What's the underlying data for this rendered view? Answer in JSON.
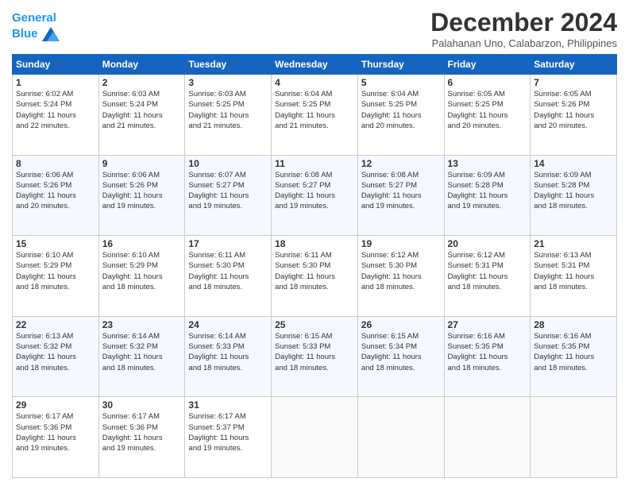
{
  "header": {
    "logo_line1": "General",
    "logo_line2": "Blue",
    "month_title": "December 2024",
    "location": "Palahanan Uno, Calabarzon, Philippines"
  },
  "days_of_week": [
    "Sunday",
    "Monday",
    "Tuesday",
    "Wednesday",
    "Thursday",
    "Friday",
    "Saturday"
  ],
  "weeks": [
    [
      {
        "day": "1",
        "text": "Sunrise: 6:02 AM\nSunset: 5:24 PM\nDaylight: 11 hours\nand 22 minutes."
      },
      {
        "day": "2",
        "text": "Sunrise: 6:03 AM\nSunset: 5:24 PM\nDaylight: 11 hours\nand 21 minutes."
      },
      {
        "day": "3",
        "text": "Sunrise: 6:03 AM\nSunset: 5:25 PM\nDaylight: 11 hours\nand 21 minutes."
      },
      {
        "day": "4",
        "text": "Sunrise: 6:04 AM\nSunset: 5:25 PM\nDaylight: 11 hours\nand 21 minutes."
      },
      {
        "day": "5",
        "text": "Sunrise: 6:04 AM\nSunset: 5:25 PM\nDaylight: 11 hours\nand 20 minutes."
      },
      {
        "day": "6",
        "text": "Sunrise: 6:05 AM\nSunset: 5:25 PM\nDaylight: 11 hours\nand 20 minutes."
      },
      {
        "day": "7",
        "text": "Sunrise: 6:05 AM\nSunset: 5:26 PM\nDaylight: 11 hours\nand 20 minutes."
      }
    ],
    [
      {
        "day": "8",
        "text": "Sunrise: 6:06 AM\nSunset: 5:26 PM\nDaylight: 11 hours\nand 20 minutes."
      },
      {
        "day": "9",
        "text": "Sunrise: 6:06 AM\nSunset: 5:26 PM\nDaylight: 11 hours\nand 19 minutes."
      },
      {
        "day": "10",
        "text": "Sunrise: 6:07 AM\nSunset: 5:27 PM\nDaylight: 11 hours\nand 19 minutes."
      },
      {
        "day": "11",
        "text": "Sunrise: 6:08 AM\nSunset: 5:27 PM\nDaylight: 11 hours\nand 19 minutes."
      },
      {
        "day": "12",
        "text": "Sunrise: 6:08 AM\nSunset: 5:27 PM\nDaylight: 11 hours\nand 19 minutes."
      },
      {
        "day": "13",
        "text": "Sunrise: 6:09 AM\nSunset: 5:28 PM\nDaylight: 11 hours\nand 19 minutes."
      },
      {
        "day": "14",
        "text": "Sunrise: 6:09 AM\nSunset: 5:28 PM\nDaylight: 11 hours\nand 18 minutes."
      }
    ],
    [
      {
        "day": "15",
        "text": "Sunrise: 6:10 AM\nSunset: 5:29 PM\nDaylight: 11 hours\nand 18 minutes."
      },
      {
        "day": "16",
        "text": "Sunrise: 6:10 AM\nSunset: 5:29 PM\nDaylight: 11 hours\nand 18 minutes."
      },
      {
        "day": "17",
        "text": "Sunrise: 6:11 AM\nSunset: 5:30 PM\nDaylight: 11 hours\nand 18 minutes."
      },
      {
        "day": "18",
        "text": "Sunrise: 6:11 AM\nSunset: 5:30 PM\nDaylight: 11 hours\nand 18 minutes."
      },
      {
        "day": "19",
        "text": "Sunrise: 6:12 AM\nSunset: 5:30 PM\nDaylight: 11 hours\nand 18 minutes."
      },
      {
        "day": "20",
        "text": "Sunrise: 6:12 AM\nSunset: 5:31 PM\nDaylight: 11 hours\nand 18 minutes."
      },
      {
        "day": "21",
        "text": "Sunrise: 6:13 AM\nSunset: 5:31 PM\nDaylight: 11 hours\nand 18 minutes."
      }
    ],
    [
      {
        "day": "22",
        "text": "Sunrise: 6:13 AM\nSunset: 5:32 PM\nDaylight: 11 hours\nand 18 minutes."
      },
      {
        "day": "23",
        "text": "Sunrise: 6:14 AM\nSunset: 5:32 PM\nDaylight: 11 hours\nand 18 minutes."
      },
      {
        "day": "24",
        "text": "Sunrise: 6:14 AM\nSunset: 5:33 PM\nDaylight: 11 hours\nand 18 minutes."
      },
      {
        "day": "25",
        "text": "Sunrise: 6:15 AM\nSunset: 5:33 PM\nDaylight: 11 hours\nand 18 minutes."
      },
      {
        "day": "26",
        "text": "Sunrise: 6:15 AM\nSunset: 5:34 PM\nDaylight: 11 hours\nand 18 minutes."
      },
      {
        "day": "27",
        "text": "Sunrise: 6:16 AM\nSunset: 5:35 PM\nDaylight: 11 hours\nand 18 minutes."
      },
      {
        "day": "28",
        "text": "Sunrise: 6:16 AM\nSunset: 5:35 PM\nDaylight: 11 hours\nand 18 minutes."
      }
    ],
    [
      {
        "day": "29",
        "text": "Sunrise: 6:17 AM\nSunset: 5:36 PM\nDaylight: 11 hours\nand 19 minutes."
      },
      {
        "day": "30",
        "text": "Sunrise: 6:17 AM\nSunset: 5:36 PM\nDaylight: 11 hours\nand 19 minutes."
      },
      {
        "day": "31",
        "text": "Sunrise: 6:17 AM\nSunset: 5:37 PM\nDaylight: 11 hours\nand 19 minutes."
      },
      null,
      null,
      null,
      null
    ]
  ]
}
